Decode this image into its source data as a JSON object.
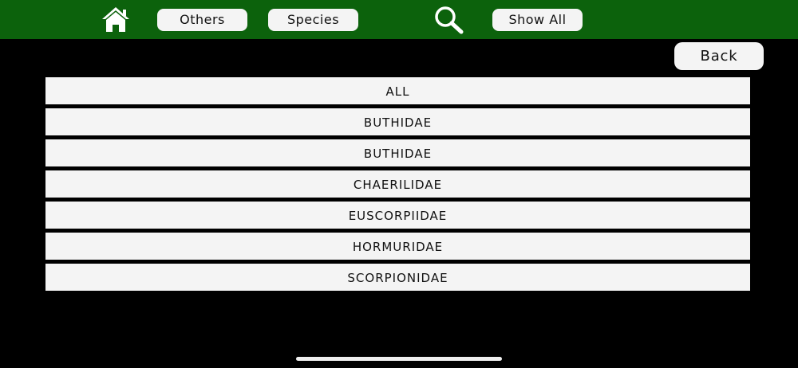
{
  "topbar": {
    "others_label": "Others",
    "species_label": "Species",
    "show_all_label": "Show All"
  },
  "back_label": "Back",
  "families": [
    {
      "label": "ALL"
    },
    {
      "label": "BUTHIDAE"
    },
    {
      "label": "BUTHIDAE"
    },
    {
      "label": "CHAERILIDAE"
    },
    {
      "label": "EUSCORPIIDAE"
    },
    {
      "label": "HORMURIDAE"
    },
    {
      "label": "SCORPIONIDAE"
    }
  ],
  "colors": {
    "topbar": "#0c620c",
    "background": "#000000",
    "button": "#f4f4f4",
    "text": "#111111"
  },
  "icons": {
    "home": "home-icon",
    "search": "search-icon"
  }
}
